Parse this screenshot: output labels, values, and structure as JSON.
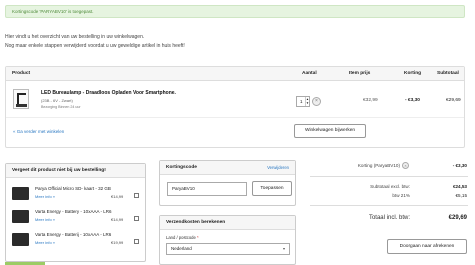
{
  "notice": {
    "text": "Kortingscode 'PARYABV10' is toegepast."
  },
  "intro": {
    "line1": "Hier vindt u het overzicht van uw bestelling in uw winkelwagen.",
    "line2": "Nog maar enkele stappen verwijderd voordat u uw geweldige artikel in huis heeft!"
  },
  "cart": {
    "headers": {
      "product": "Product",
      "qty": "Aantal",
      "unit_price": "Item prijs",
      "discount": "Korting",
      "subtotal": "Subtotaal"
    },
    "item": {
      "name": "LED Bureaulamp - Draadloos Opladen Voor Smartphone.",
      "variant": "(23B - 6V - Zwart)",
      "stock": "Bezorging Binnen 24 uur",
      "qty": "1",
      "unit_price": "€32,99",
      "discount": "- €3,30",
      "subtotal": "€29,69"
    },
    "back_link": "« Ga verder met winkelen",
    "update_button": "Winkelwagen bijwerken"
  },
  "cross_sell": {
    "title": "Vergeet dit product niet bij uw bestelling!",
    "items": [
      {
        "name": "Parya Official Micro SD- kaart - 32 GB",
        "more": "Meer info »",
        "price": "€14,99"
      },
      {
        "name": "Varta Energy - Battery - 10xAAA - LR6",
        "more": "Meer info »",
        "price": "€14,99"
      },
      {
        "name": "Varta Energy - Batterij - 10xAAA - LR6",
        "more": "Meer info »",
        "price": "€19,99"
      }
    ]
  },
  "coupon": {
    "title": "Kortingscode",
    "remove_link": "Verwijderen",
    "value": "ParyaBV10",
    "apply_button": "Toepassen"
  },
  "shipping": {
    "title": "Verzendkosten berekenen",
    "country_label": "Land / postcode",
    "required_mark": "*",
    "country_value": "Nederland"
  },
  "summary": {
    "discount_label": "Korting (ParyaBV10)",
    "discount_value": "- €3,30",
    "subtotal_label": "Subtotaal excl. btw:",
    "subtotal_value": "€24,53",
    "vat_label": "btw 21%",
    "vat_value": "€5,15",
    "total_label": "Totaal incl. btw:",
    "total_value": "€29,69",
    "checkout_button": "Doorgaan naar afrekenen"
  },
  "colors": {
    "link": "#2a78c2",
    "notice_bg": "#e6f4e0",
    "notice_text": "#4e8a3a"
  }
}
